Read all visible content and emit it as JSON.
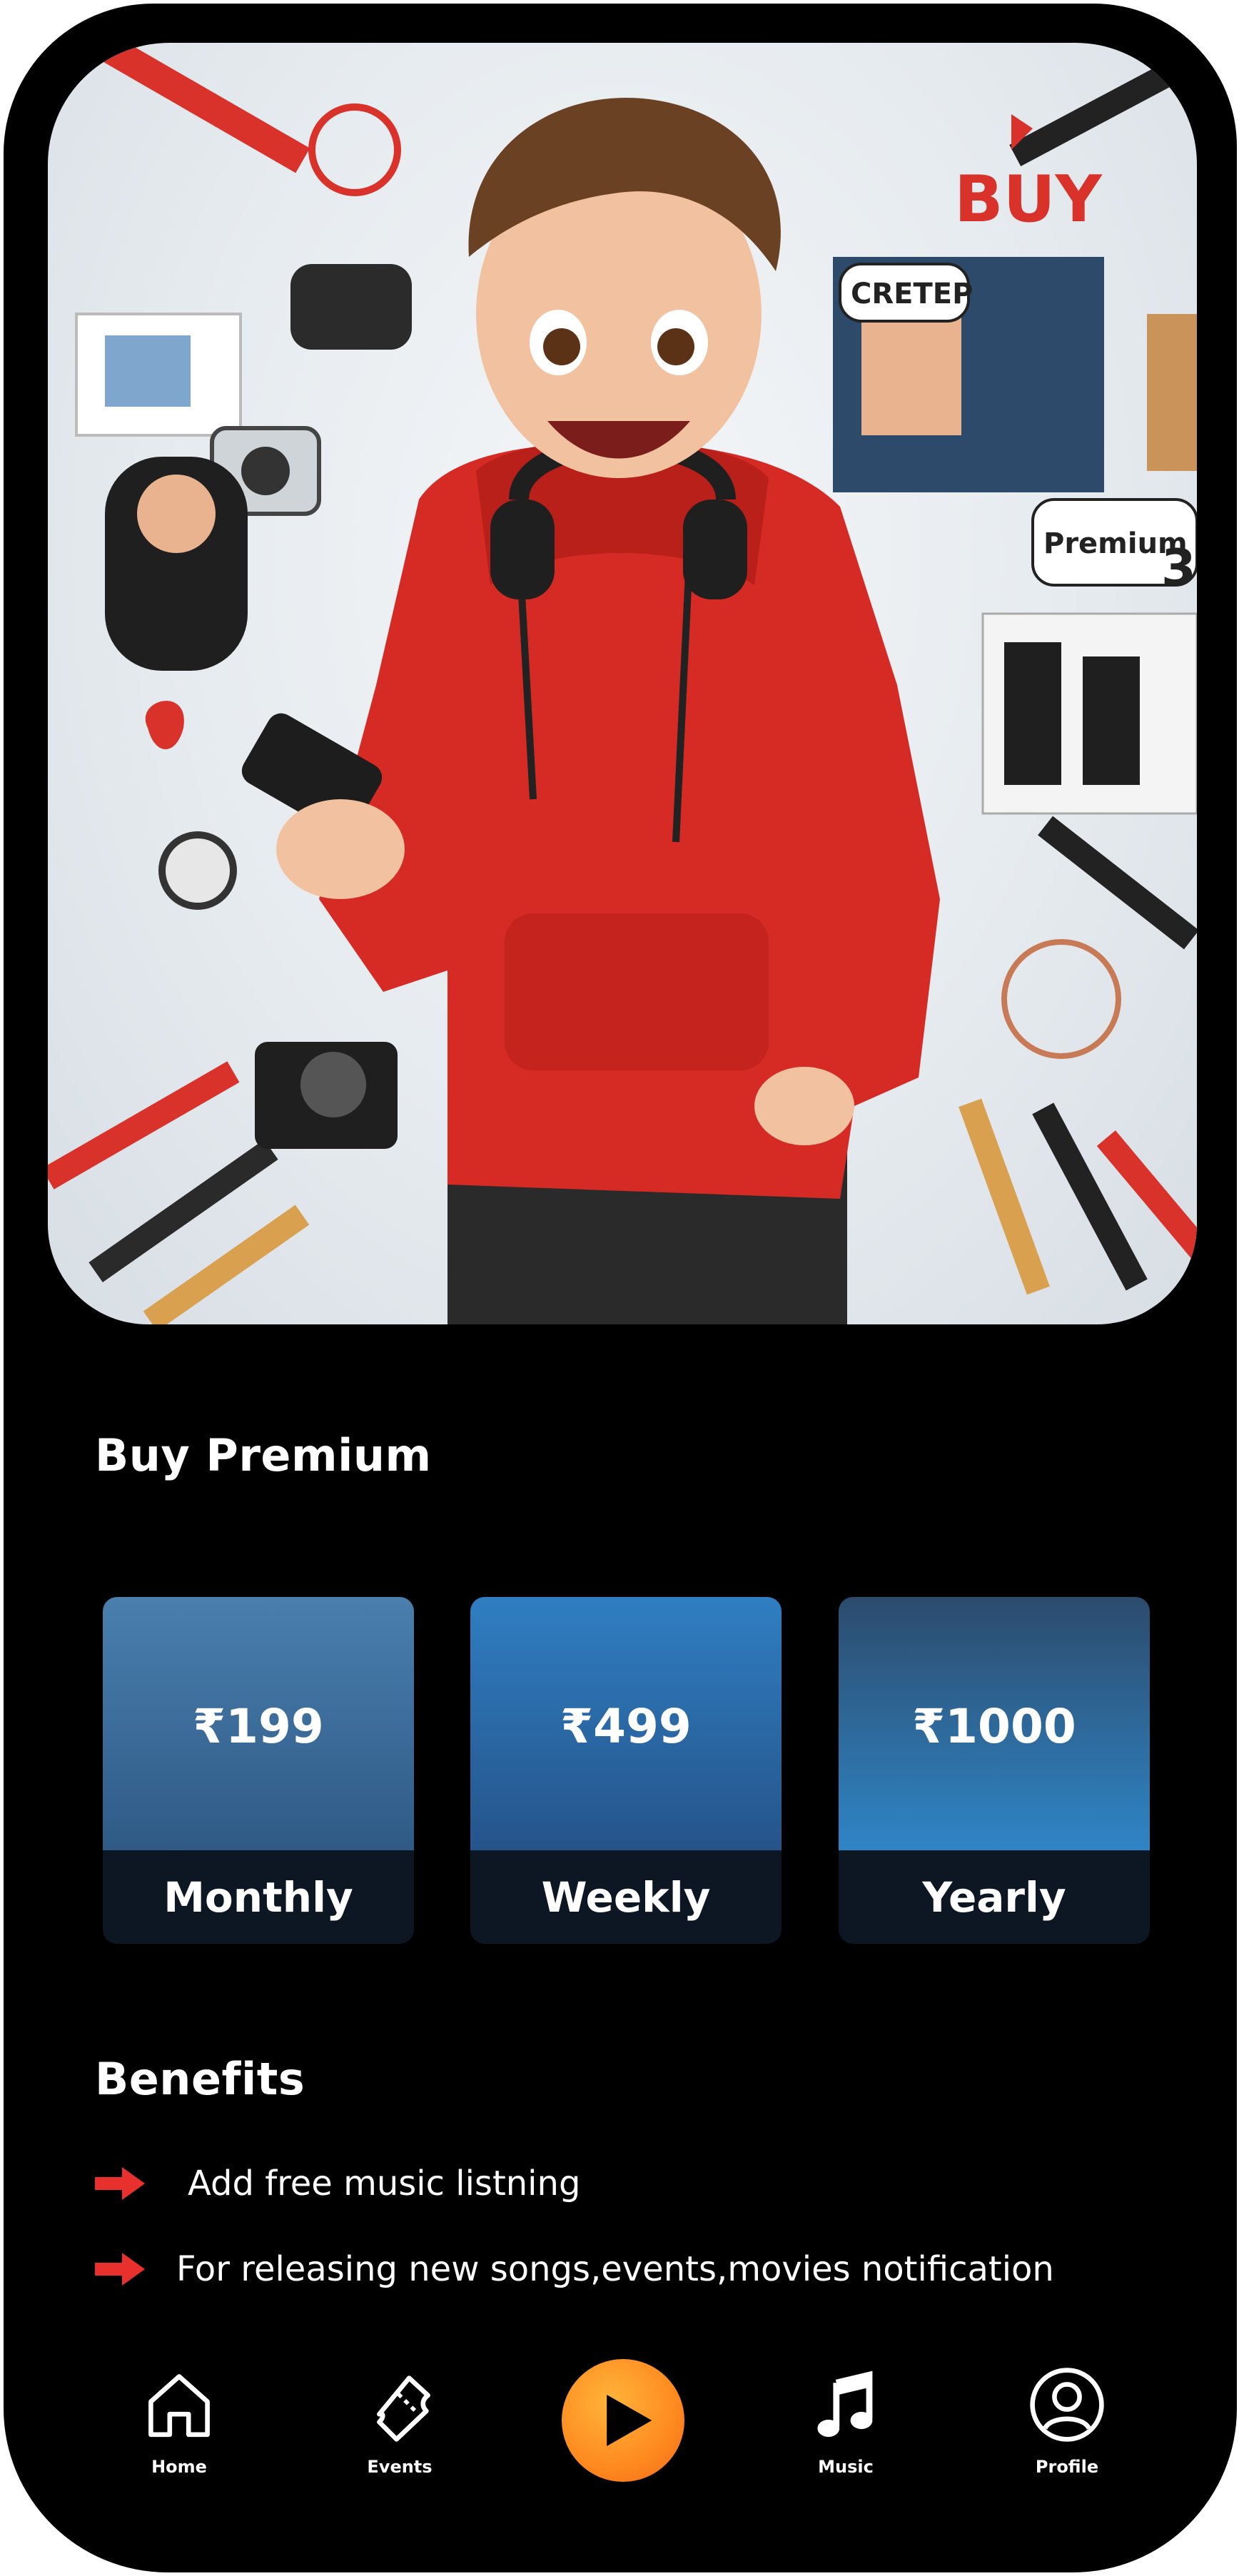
{
  "screen": {
    "section_title": "Buy Premium",
    "benefits_title": "Benefits"
  },
  "plans": [
    {
      "price": "₹199",
      "name": "Monthly"
    },
    {
      "price": "₹499",
      "name": "Weekly"
    },
    {
      "price": "₹1000",
      "name": "Yearly"
    }
  ],
  "benefits": [
    {
      "text": "Add free music listning"
    },
    {
      "text": "For releasing new songs,events,movies notification"
    }
  ],
  "nav": {
    "items": [
      {
        "label": "Home",
        "icon": "home-icon"
      },
      {
        "label": "Events",
        "icon": "ticket-icon"
      },
      {
        "label": "",
        "icon": "play-icon"
      },
      {
        "label": "Music",
        "icon": "music-note-icon"
      },
      {
        "label": "Profile",
        "icon": "user-icon"
      }
    ]
  },
  "hero_image": {
    "text_in_image": [
      "CRETEP",
      "BUY",
      "Premium",
      "3"
    ]
  },
  "colors": {
    "background": "#000000",
    "accent_orange": "#ff8a1f",
    "arrow_red": "#e8302c",
    "card_blue": "#2f7ec2",
    "card_dark": "#0c1723"
  }
}
